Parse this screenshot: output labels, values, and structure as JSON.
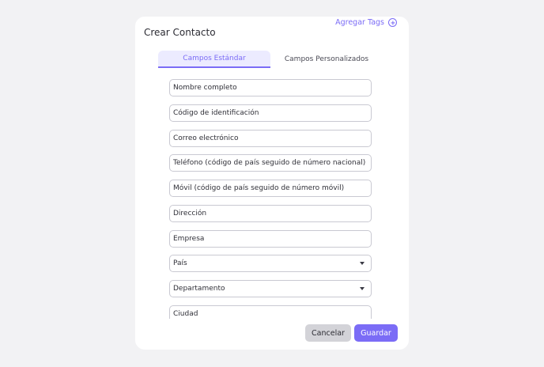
{
  "dialog": {
    "title": "Crear Contacto",
    "tags_link": "Agregar Tags",
    "tags_icon": "plus-circle-icon"
  },
  "tabs": [
    {
      "label": "Campos Estándar",
      "active": true
    },
    {
      "label": "Campos Personalizados",
      "active": false
    }
  ],
  "fields": [
    {
      "placeholder": "Nombre completo",
      "type": "text"
    },
    {
      "placeholder": "Código de identificación",
      "type": "text"
    },
    {
      "placeholder": "Correo electrónico",
      "type": "text"
    },
    {
      "placeholder": "Teléfono (código de país seguido de número nacional)",
      "type": "text"
    },
    {
      "placeholder": "Móvil (código de país seguido de número móvil)",
      "type": "text"
    },
    {
      "placeholder": "Dirección",
      "type": "text"
    },
    {
      "placeholder": "Empresa",
      "type": "text"
    },
    {
      "placeholder": "País",
      "type": "select"
    },
    {
      "placeholder": "Departamento",
      "type": "select"
    },
    {
      "placeholder": "Ciudad",
      "type": "text"
    }
  ],
  "buttons": {
    "cancel": "Cancelar",
    "save": "Guardar"
  },
  "colors": {
    "accent": "#7b6cf6",
    "background": "#f2f2f4",
    "cancel_bg": "#d3d3d8"
  }
}
